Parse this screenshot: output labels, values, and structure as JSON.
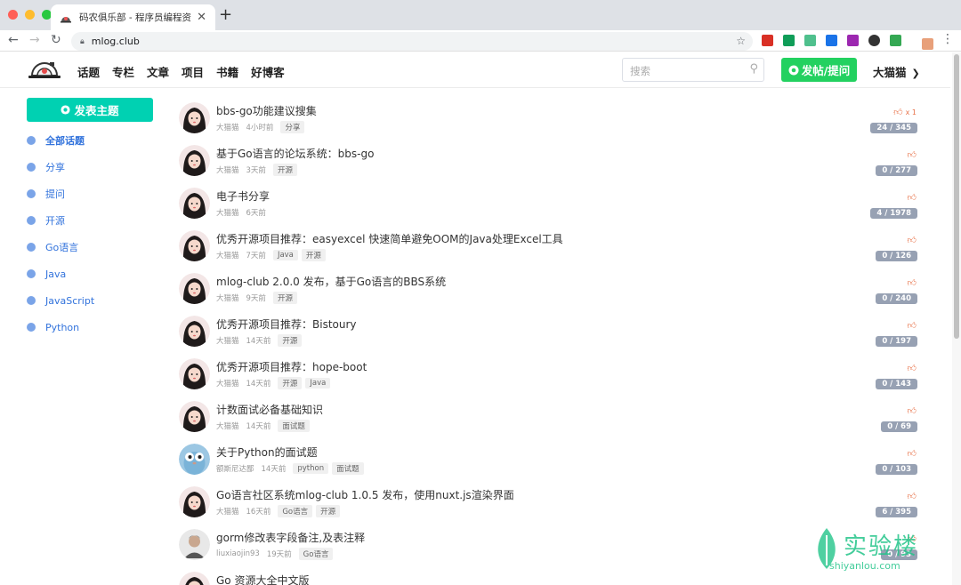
{
  "browser": {
    "tab_title": "码农俱乐部 - 程序员编程资料和",
    "url": "mlog.club"
  },
  "header": {
    "nav": [
      "话题",
      "专栏",
      "文章",
      "项目",
      "书籍",
      "好博客"
    ],
    "search_placeholder": "搜索",
    "post_button": "发帖/提问",
    "username": "大猫猫"
  },
  "sidebar": {
    "new_topic": "发表主题",
    "categories": [
      "全部话题",
      "分享",
      "提问",
      "开源",
      "Go语言",
      "Java",
      "JavaScript",
      "Python"
    ]
  },
  "topics": [
    {
      "title": "bbs-go功能建议搜集",
      "author": "大猫猫",
      "time": "4小时前",
      "tags": [
        "分享"
      ],
      "stats": "24 / 345",
      "likes": "x 1",
      "avatar": "girl"
    },
    {
      "title": "基于Go语言的论坛系统：bbs-go",
      "author": "大猫猫",
      "time": "3天前",
      "tags": [
        "开源"
      ],
      "stats": "0 / 277",
      "likes": "",
      "avatar": "girl"
    },
    {
      "title": "电子书分享",
      "author": "大猫猫",
      "time": "6天前",
      "tags": [],
      "stats": "4 / 1978",
      "likes": "",
      "avatar": "girl"
    },
    {
      "title": "优秀开源项目推荐：easyexcel 快速简单避免OOM的Java处理Excel工具",
      "author": "大猫猫",
      "time": "7天前",
      "tags": [
        "Java",
        "开源"
      ],
      "stats": "0 / 126",
      "likes": "",
      "avatar": "girl"
    },
    {
      "title": "mlog-club 2.0.0 发布，基于Go语言的BBS系统",
      "author": "大猫猫",
      "time": "9天前",
      "tags": [
        "开源"
      ],
      "stats": "0 / 240",
      "likes": "",
      "avatar": "girl"
    },
    {
      "title": "优秀开源项目推荐：Bistoury",
      "author": "大猫猫",
      "time": "14天前",
      "tags": [
        "开源"
      ],
      "stats": "0 / 197",
      "likes": "",
      "avatar": "girl"
    },
    {
      "title": "优秀开源项目推荐：hope-boot",
      "author": "大猫猫",
      "time": "14天前",
      "tags": [
        "开源",
        "Java"
      ],
      "stats": "0 / 143",
      "likes": "",
      "avatar": "girl"
    },
    {
      "title": "计数面试必备基础知识",
      "author": "大猫猫",
      "time": "14天前",
      "tags": [
        "面试题"
      ],
      "stats": "0 / 69",
      "likes": "",
      "avatar": "girl"
    },
    {
      "title": "关于Python的面试题",
      "author": "额斯尼达鄙",
      "time": "14天前",
      "tags": [
        "python",
        "面试题"
      ],
      "stats": "0 / 103",
      "likes": "",
      "avatar": "robot"
    },
    {
      "title": "Go语言社区系统mlog-club 1.0.5 发布，使用nuxt.js渲染界面",
      "author": "大猫猫",
      "time": "16天前",
      "tags": [
        "Go语言",
        "开源"
      ],
      "stats": "6 / 395",
      "likes": "",
      "avatar": "girl"
    },
    {
      "title": "gorm修改表字段备注,及表注释",
      "author": "liuxiaojin93",
      "time": "19天前",
      "tags": [
        "Go语言"
      ],
      "stats": "0 / 93",
      "likes": "",
      "avatar": "man"
    },
    {
      "title": "Go 资源大全中文版",
      "author": "",
      "time": "",
      "tags": [],
      "stats": "",
      "likes": "",
      "avatar": "girl"
    }
  ],
  "watermark": {
    "brand": "实验楼",
    "domain": "shiyanlou.com"
  }
}
